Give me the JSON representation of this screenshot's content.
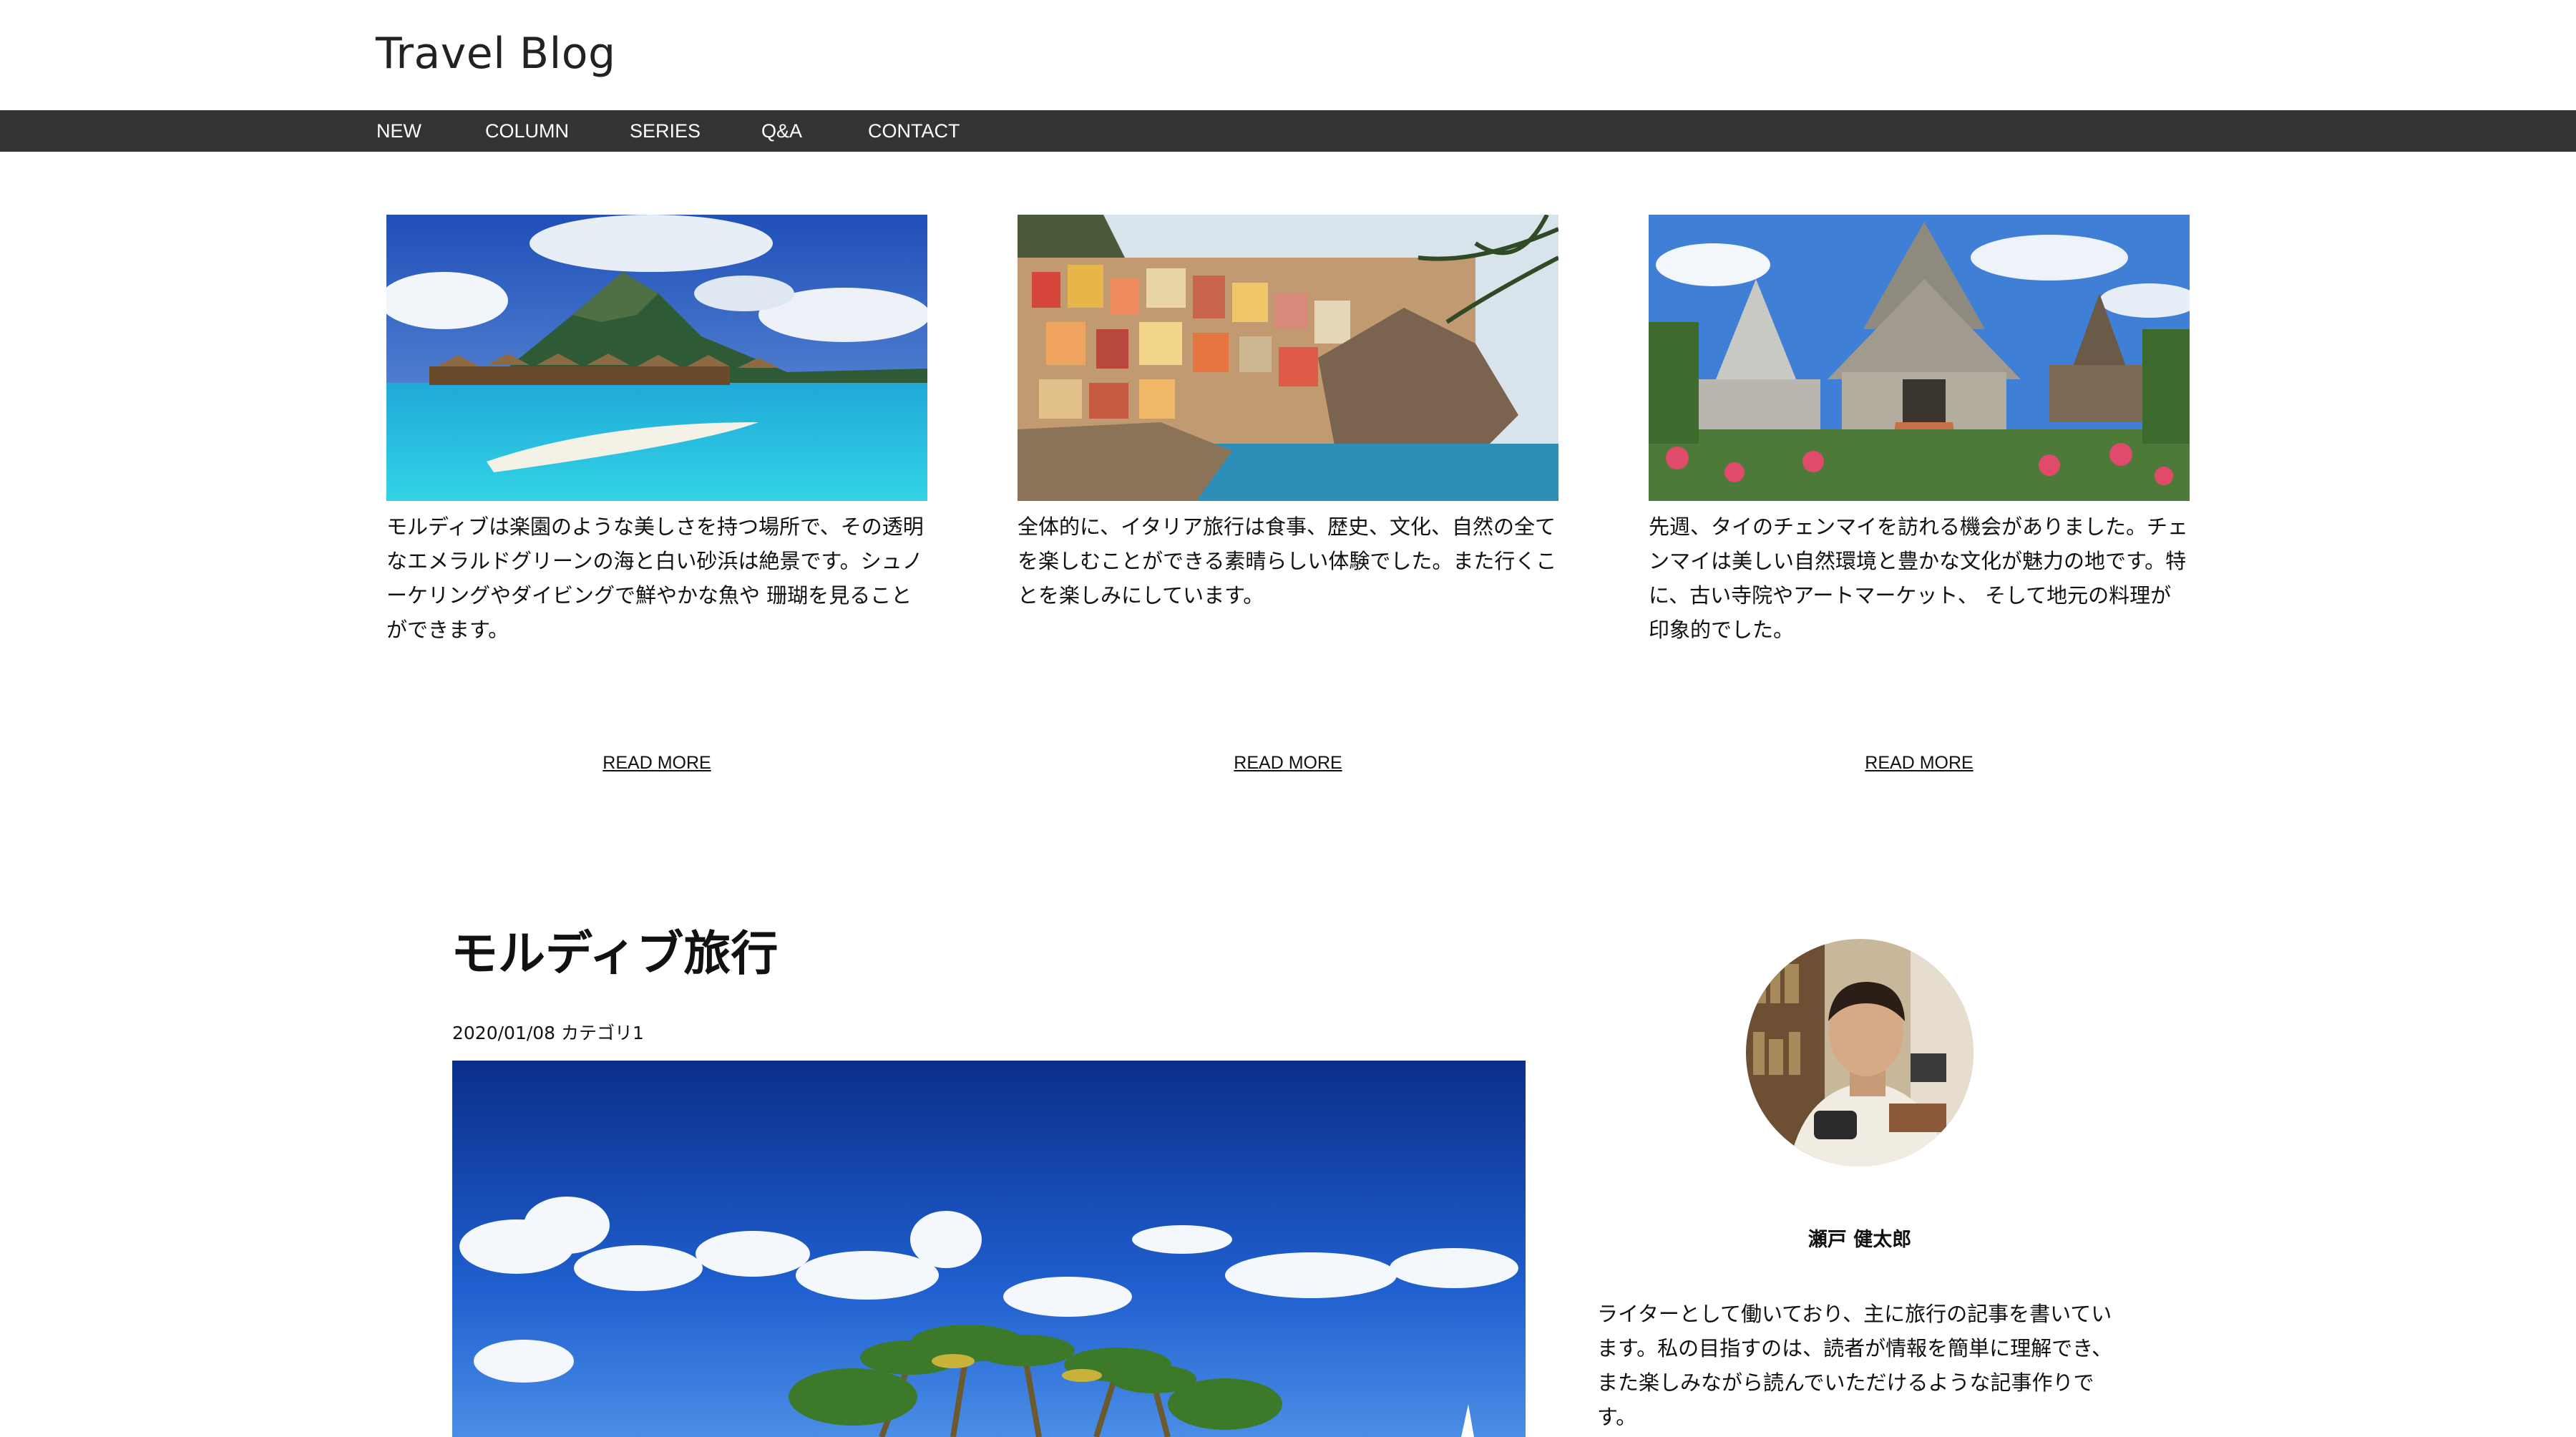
{
  "header": {
    "site_title": "Travel Blog"
  },
  "nav": {
    "items": [
      {
        "label": "NEW"
      },
      {
        "label": "COLUMN"
      },
      {
        "label": "SERIES"
      },
      {
        "label": "Q&A"
      },
      {
        "label": "CONTACT"
      }
    ]
  },
  "cards": [
    {
      "text": "モルディブは楽園のような美しさを持つ場所で、その透明なエメラルドグリーンの海と白い砂浜は絶景です。シュノーケリングやダイビングで鮮やかな魚や 珊瑚を見ることができます。",
      "read_more": "READ MORE"
    },
    {
      "text": "全体的に、イタリア旅行は食事、歴史、文化、自然の全てを楽しむことができる素晴らしい体験でした。また行くことを楽しみにしています。",
      "read_more": "READ MORE"
    },
    {
      "text": "先週、タイのチェンマイを訪れる機会がありました。チェンマイは美しい自然環境と豊かな文化が魅力の地です。特に、古い寺院やアートマーケット、 そして地元の料理が印象的でした。",
      "read_more": "READ MORE"
    }
  ],
  "article": {
    "title": "モルディブ旅行",
    "meta": "2020/01/08 カテゴリ1"
  },
  "profile": {
    "name": "瀬戸 健太郎",
    "bio": "ライターとして働いており、主に旅行の記事を書いています。私の目指すのは、読者が情報を簡単に理解でき、また楽しみながら読んでいただけるような記事作りです。"
  },
  "colors": {
    "nav_background": "#333333",
    "nav_text": "#ffffff",
    "page_background": "#ffffff"
  }
}
